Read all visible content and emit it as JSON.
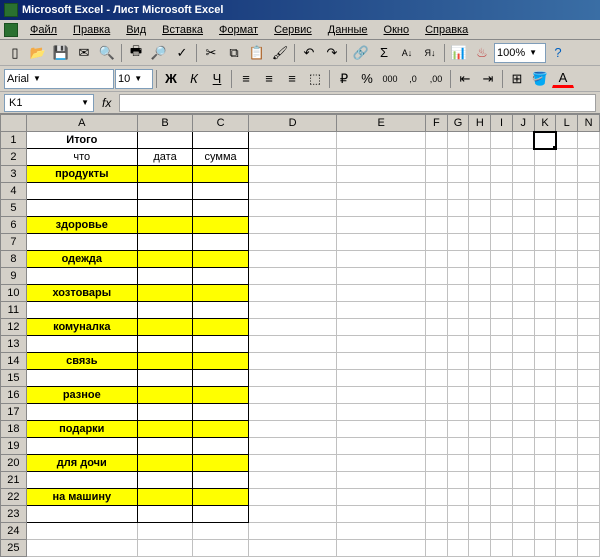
{
  "title": "Microsoft Excel - Лист Microsoft Excel",
  "menu": {
    "file": "Файл",
    "edit": "Правка",
    "view": "Вид",
    "insert": "Вставка",
    "format": "Формат",
    "tools": "Сервис",
    "data": "Данные",
    "window": "Окно",
    "help": "Справка"
  },
  "font": {
    "name": "Arial",
    "size": "10"
  },
  "zoom": "100%",
  "nameBox": "K1",
  "columns": [
    "A",
    "B",
    "C",
    "D",
    "E",
    "F",
    "G",
    "H",
    "I",
    "J",
    "K",
    "L",
    "N"
  ],
  "activeColumn": "K",
  "sheet": {
    "A1": "Итого",
    "A2": "что",
    "B2": "дата",
    "C2": "сумма",
    "A3": "продукты",
    "A6": "здоровье",
    "A8": "одежда",
    "A10": "хозтовары",
    "A12": "комуналка",
    "A14": "связь",
    "A16": "разное",
    "A18": "подарки",
    "A20": "для дочи",
    "A22": "на машину"
  }
}
